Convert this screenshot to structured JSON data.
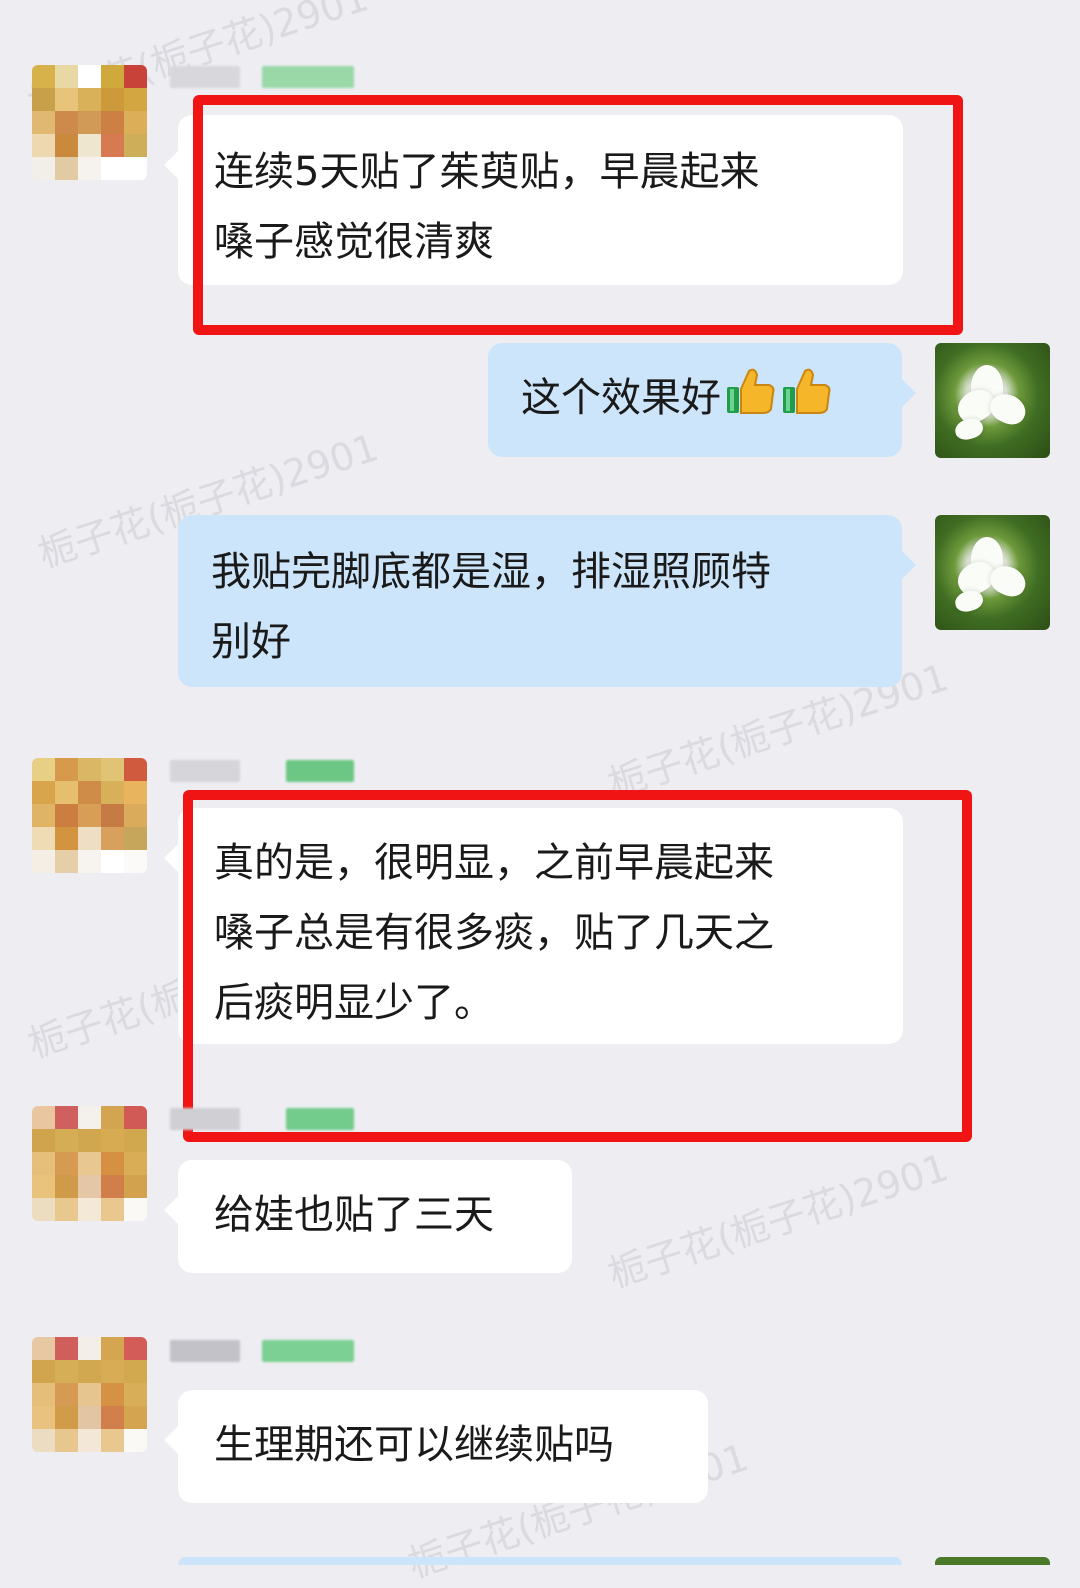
{
  "watermark_text": "栀子花(栀子花)2901",
  "colors": {
    "background": "#ededf2",
    "bubble_left": "#ffffff",
    "bubble_right": "#cde5fa",
    "highlight": "#f01414"
  },
  "messages": [
    {
      "side": "left",
      "text_lines": [
        "连续5天贴了茱萸贴，早晨起来",
        "嗓子感觉很清爽"
      ],
      "highlighted": true
    },
    {
      "side": "right",
      "text": "这个效果好",
      "emoji": [
        "thumbs-up",
        "thumbs-up"
      ]
    },
    {
      "side": "right",
      "text_lines": [
        "我贴完脚底都是湿，排湿照顾特",
        "别好"
      ]
    },
    {
      "side": "left",
      "text_lines": [
        "真的是，很明显，之前早晨起来",
        "嗓子总是有很多痰，贴了几天之",
        "后痰明显少了。"
      ],
      "highlighted": true
    },
    {
      "side": "left",
      "text": "给娃也贴了三天"
    },
    {
      "side": "left",
      "text": "生理期还可以继续贴吗"
    }
  ]
}
